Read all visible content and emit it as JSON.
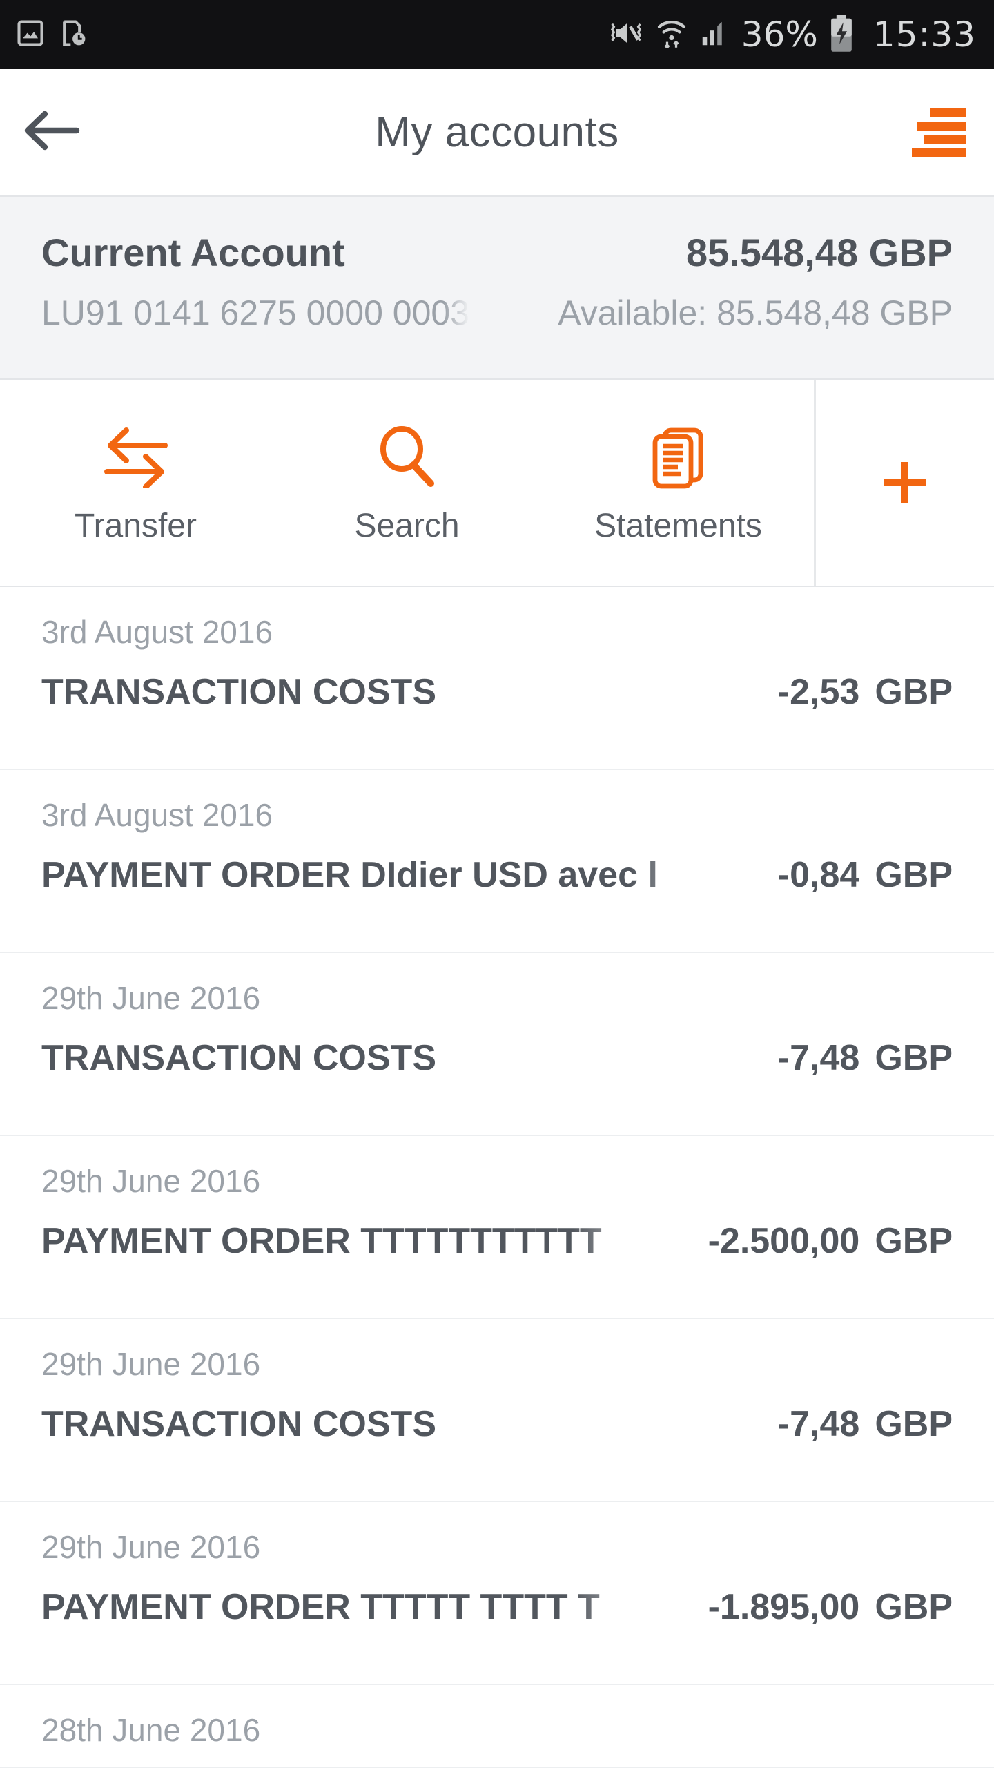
{
  "statusbar": {
    "battery_percent": "36%",
    "time": "15:33",
    "icons": [
      "image-icon",
      "document-clock-icon",
      "mute-vibrate-icon",
      "wifi-icon",
      "signal-icon",
      "battery-charging-icon"
    ]
  },
  "header": {
    "title": "My accounts",
    "back_icon": "back-arrow-icon",
    "menu_icon": "hamburger-menu-icon",
    "accent_color": "#F26611"
  },
  "account": {
    "name": "Current Account",
    "iban": "LU91 0141 6275 0000 0003",
    "balance": "85.548,48 GBP",
    "available": "Available: 85.548,48 GBP"
  },
  "actions": [
    {
      "label": "Transfer",
      "icon": "transfer-arrows-icon"
    },
    {
      "label": "Search",
      "icon": "search-magnifier-icon"
    },
    {
      "label": "Statements",
      "icon": "documents-stack-icon"
    }
  ],
  "add_button": {
    "icon": "plus-icon"
  },
  "transactions": [
    {
      "date": "3rd August 2016",
      "description": "TRANSACTION COSTS",
      "amount": "-2,53",
      "currency": "GBP",
      "truncated": false
    },
    {
      "date": "3rd August 2016",
      "description": "PAYMENT ORDER DIdier USD avec l",
      "amount": "-0,84",
      "currency": "GBP",
      "truncated": true
    },
    {
      "date": "29th June 2016",
      "description": "TRANSACTION COSTS",
      "amount": "-7,48",
      "currency": "GBP",
      "truncated": false
    },
    {
      "date": "29th June 2016",
      "description": "PAYMENT ORDER TTTTTTTTTTT",
      "amount": "-2.500,00",
      "currency": "GBP",
      "truncated": true
    },
    {
      "date": "29th June 2016",
      "description": "TRANSACTION COSTS",
      "amount": "-7,48",
      "currency": "GBP",
      "truncated": false
    },
    {
      "date": "29th June 2016",
      "description": "PAYMENT ORDER TTTTT TTTT T",
      "amount": "-1.895,00",
      "currency": "GBP",
      "truncated": true
    },
    {
      "date": "28th June 2016",
      "description": "",
      "amount": "",
      "currency": "",
      "truncated": false
    }
  ]
}
